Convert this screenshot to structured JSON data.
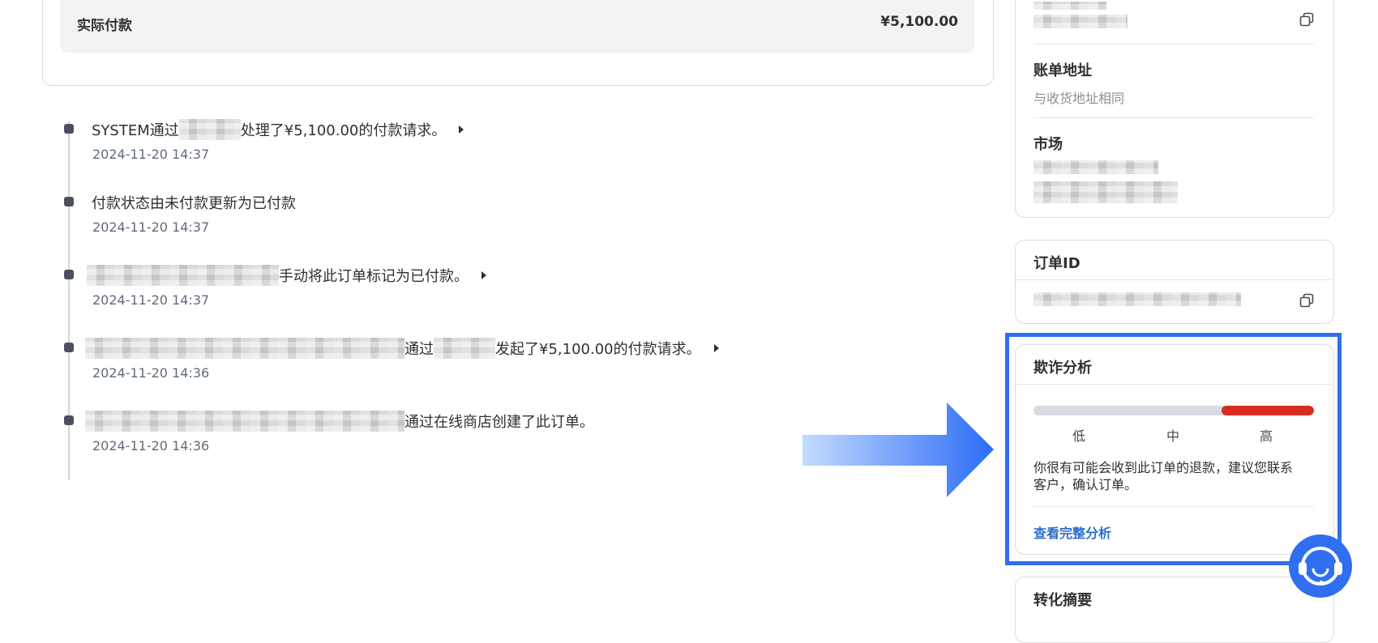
{
  "payment_summary": {
    "label": "实际付款",
    "amount": "¥5,100.00"
  },
  "timeline": [
    {
      "parts": [
        "SYSTEM通过",
        "",
        "处理了¥5,100.00的付款请求。"
      ],
      "time": "2024-11-20 14:37",
      "expandable": true
    },
    {
      "parts": [
        "付款状态由未付款更新为已付款"
      ],
      "time": "2024-11-20 14:37",
      "expandable": false
    },
    {
      "parts": [
        "",
        "手动将此订单标记为已付款。"
      ],
      "time": "2024-11-20 14:37",
      "expandable": true
    },
    {
      "parts": [
        "",
        "通过",
        "",
        "发起了¥5,100.00的付款请求。"
      ],
      "time": "2024-11-20 14:36",
      "expandable": true
    },
    {
      "parts": [
        "",
        "通过在线商店创建了此订单。"
      ],
      "time": "2024-11-20 14:36",
      "expandable": false
    }
  ],
  "customer_card": {
    "billing_title": "账单地址",
    "billing_value": "与收货地址相同",
    "market_title": "市场"
  },
  "order_id_card": {
    "title": "订单ID"
  },
  "fraud_card": {
    "title": "欺诈分析",
    "risk_level_fraction": 0.33,
    "labels": [
      "低",
      "中",
      "高"
    ],
    "description_line1": "你很有可能会收到此订单的退款，建议您联系",
    "description_line2": "客户，确认订单。",
    "link": "查看完整分析",
    "risk_color": "#d72c20",
    "highlight_color": "#2f6ff0"
  },
  "conversion_card": {
    "title": "转化摘要"
  },
  "icons": {
    "copy": "copy-icon",
    "support": "support-headset-icon",
    "arrow": "pointer-arrow-icon"
  }
}
